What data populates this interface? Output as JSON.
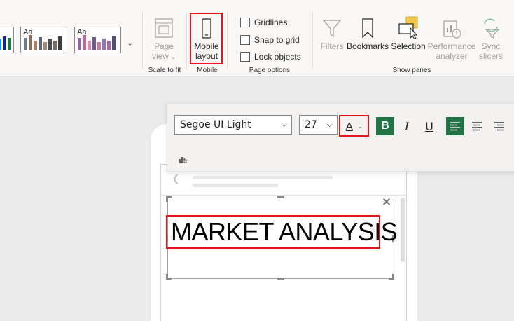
{
  "ribbon": {
    "themes": [
      {
        "label": "Aa"
      },
      {
        "label": "Aa"
      }
    ],
    "page_view": {
      "line1": "Page",
      "line2": "view"
    },
    "mobile_layout": {
      "line1": "Mobile",
      "line2": "layout"
    },
    "checkboxes": [
      {
        "label": "Gridlines"
      },
      {
        "label": "Snap to grid"
      },
      {
        "label": "Lock objects"
      }
    ],
    "panes": [
      {
        "label": "Filters"
      },
      {
        "label": "Bookmarks"
      },
      {
        "label": "Selection"
      },
      {
        "line1": "Performance",
        "line2": "analyzer"
      },
      {
        "line1": "Sync",
        "line2": "slicers"
      }
    ],
    "group_labels": {
      "scale": "Scale to fit",
      "mobile": "Mobile",
      "page_options": "Page options",
      "show_panes": "Show panes"
    }
  },
  "format_toolbar": {
    "font_family": "Segoe UI Light",
    "font_size": "27",
    "font_color_letter": "A",
    "bold_label": "B",
    "italic_label": "I",
    "underline_label": "U"
  },
  "canvas": {
    "textbox_text": "MARKET ANALYSIS"
  },
  "colors": {
    "highlight": "#e8121b",
    "bold_active": "#217346",
    "ribbon_bg": "#f9f8f7",
    "canvas_bg": "#ebebeb"
  }
}
